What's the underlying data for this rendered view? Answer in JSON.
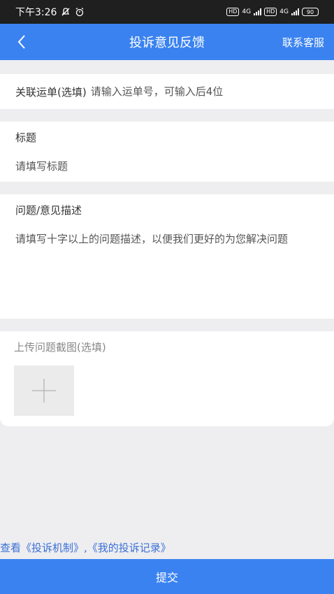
{
  "status_bar": {
    "time": "下午3:26",
    "network_1": "4G",
    "network_2": "4G",
    "hd_1": "HD",
    "hd_2": "HD",
    "battery": "90"
  },
  "navbar": {
    "title": "投诉意见反馈",
    "right_action": "联系客服",
    "back_icon": "chevron-left-icon"
  },
  "waybill": {
    "label": "关联运单(选填)",
    "placeholder": "请输入运单号，可输入后4位"
  },
  "title_field": {
    "label": "标题",
    "placeholder": "请填写标题"
  },
  "description": {
    "label": "问题/意见描述",
    "placeholder": "请填写十字以上的问题描述，以便我们更好的为您解决问题"
  },
  "upload": {
    "label": "上传问题截图(选填)",
    "add_icon": "plus-icon"
  },
  "footer": {
    "links_text": "查看《投诉机制》,《我的投诉记录》"
  },
  "submit": {
    "label": "提交"
  },
  "colors": {
    "primary": "#3a82f0",
    "link": "#3a6fd6",
    "background": "#eeeef0"
  }
}
